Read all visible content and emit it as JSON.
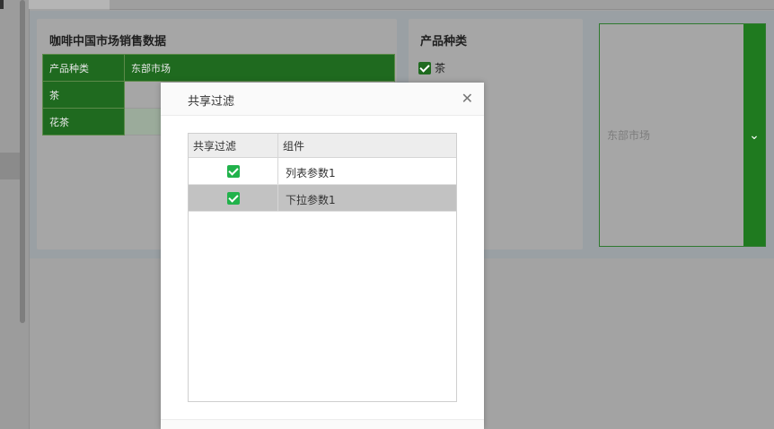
{
  "table_widget": {
    "title": "咖啡中国市场销售数据",
    "header": [
      "产品种类",
      "东部市场"
    ],
    "rows": [
      [
        "茶",
        ""
      ],
      [
        "花茶",
        ""
      ]
    ]
  },
  "checkbox_widget": {
    "title": "产品种类",
    "items": [
      {
        "label": "茶",
        "checked": true
      }
    ]
  },
  "dropdown_widget": {
    "value": "东部市场",
    "button_icon": "chevron-down-icon"
  },
  "modal": {
    "title": "共享过滤",
    "close_icon": "close-icon",
    "columns": [
      "共享过滤",
      "组件"
    ],
    "rows": [
      {
        "checked": true,
        "name": "列表参数1",
        "selected": false
      },
      {
        "checked": true,
        "name": "下拉参数1",
        "selected": true
      }
    ]
  },
  "colors": {
    "accent_green": "#1f7a1f",
    "check_green": "#21b24b"
  }
}
